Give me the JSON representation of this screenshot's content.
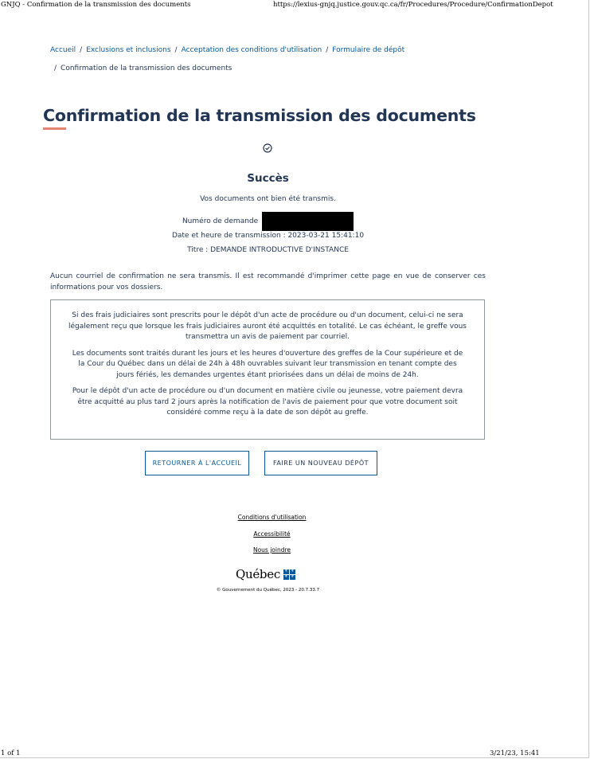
{
  "browser": {
    "tab_title": "GNJQ - Confirmation de la transmission des documents",
    "url": "https://lexius-gnjq.justice.gouv.qc.ca/fr/Procedures/Procedure/ConfirmationDepot",
    "page_count": "1 of 1",
    "print_datetime": "3/21/23, 15:41"
  },
  "breadcrumb": {
    "items": [
      "Accueil",
      "Exclusions et inclusions",
      "Acceptation des conditions d'utilisation",
      "Formulaire de dépôt"
    ],
    "current": "Confirmation de la transmission des documents",
    "separator": "/"
  },
  "page_title": "Confirmation de la transmission des documents",
  "confirmation": {
    "icon": "check-circle-icon",
    "heading": "Succès",
    "message": "Vos documents ont bien été transmis.",
    "request_number_label": "Numéro de demande",
    "transmission_datetime": "Date et heure de transmission : 2023-03-21 15:41:10",
    "title_line": "Titre : DEMANDE INTRODUCTIVE D'INSTANCE"
  },
  "notice": "Aucun courriel de confirmation ne sera transmis. Il est recommandé d'imprimer cette page en vue de conserver ces informations pour vos dossiers.",
  "info_box": {
    "paragraphs": [
      "Si des frais judiciaires sont prescrits pour le dépôt d'un acte de procédure ou d'un document, celui-ci ne sera légalement reçu que lorsque les frais judiciaires auront été acquittés en totalité. Le cas échéant, le greffe vous transmettra un avis de paiement par courriel.",
      "Les documents sont traités durant les jours et les heures d'ouverture des greffes de la Cour supérieure et de la Cour du Québec dans un délai de 24h à 48h ouvrables suivant leur transmission en tenant compte des jours fériés, les demandes urgentes étant priorisées dans un délai de moins de 24h.",
      "Pour le dépôt d'un acte de procédure ou d'un document en matière civile ou jeunesse, votre paiement devra être acquitté au plus tard 2 jours après la notification de l'avis de paiement pour que votre document soit considéré comme reçu à la date de son dépôt au greffe."
    ]
  },
  "buttons": {
    "home": "Retourner à l'accueil",
    "new_deposit": "Faire un nouveau dépôt"
  },
  "footer": {
    "links": [
      "Conditions d'utilisation",
      "Accessibilité",
      "Nous joindre"
    ],
    "logo_text": "Québec",
    "copyright": "© Gouvernement du Québec, 2023 - 20.7.33.7"
  },
  "colors": {
    "link": "#095797",
    "heading": "#223654",
    "accent_underline": "#e58271",
    "redaction": "#000000"
  }
}
